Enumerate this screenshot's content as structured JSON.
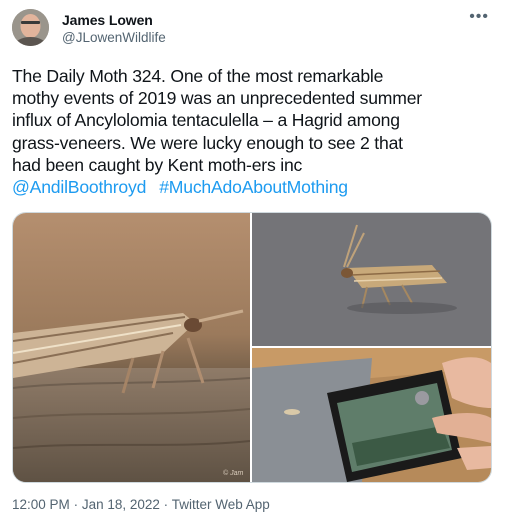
{
  "author": {
    "name": "James Lowen",
    "handle": "@JLowenWildlife"
  },
  "menu_icon": "more-horizontal-icon",
  "tweet": {
    "text": "The Daily Moth 324. One of the most remarkable\nmothy events of 2019 was an unprecedented summer\ninflux of Ancylolomia tentaculella – a Hagrid among\ngrass-veneers. We were lucky enough to see 2 that\nhad been caught by Kent moth-ers inc",
    "mentions": [
      "@AndilBoothroyd",
      "#MuchAdoAboutMothing"
    ]
  },
  "media": {
    "watermark": "© Jam"
  },
  "footer": {
    "time": "12:00 PM",
    "date": "Jan 18, 2022",
    "source": "Twitter Web App",
    "separator": "·"
  },
  "colors": {
    "link": "#1d9bf0",
    "secondary_text": "#536471"
  }
}
